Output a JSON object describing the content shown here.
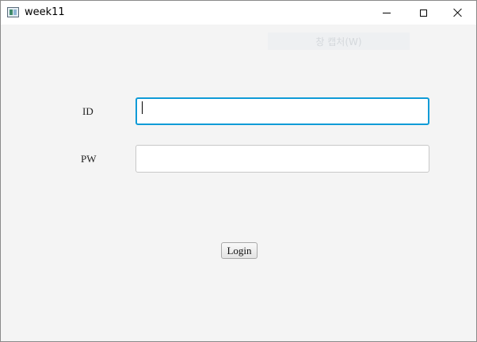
{
  "window": {
    "title": "week11",
    "app_icon": "java-app-icon",
    "controls": {
      "minimize_icon": "minimize-icon",
      "maximize_icon": "maximize-icon",
      "close_icon": "close-icon"
    }
  },
  "overlay": {
    "faded_label": "창 캡처(W)"
  },
  "form": {
    "id_label": "ID",
    "id_value": "",
    "pw_label": "PW",
    "pw_value": "",
    "focused_field": "id"
  },
  "actions": {
    "login_label": "Login"
  },
  "colors": {
    "background": "#f4f4f4",
    "focus_border": "#0f9bd7",
    "titlebar": "#ffffff"
  }
}
